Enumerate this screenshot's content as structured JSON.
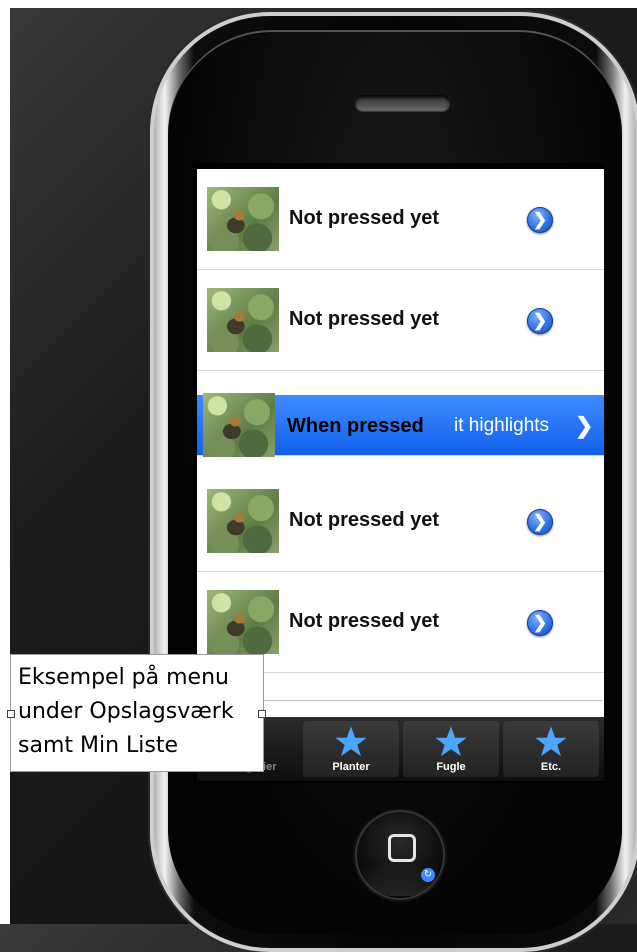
{
  "list": {
    "rows": [
      {
        "label": "Not pressed yet",
        "disclosure": "❯"
      },
      {
        "label": "Not pressed yet",
        "disclosure": "❯"
      },
      {
        "label": "When pressed",
        "hint": "it highlights",
        "chevron": "❯"
      },
      {
        "label": "Not pressed yet",
        "disclosure": "❯"
      },
      {
        "label": "Not pressed yet",
        "disclosure": "❯"
      }
    ]
  },
  "tabbar": {
    "tabs": [
      {
        "label": "Kategorier",
        "icon": "star-icon"
      },
      {
        "label": "Planter",
        "icon": "star-icon"
      },
      {
        "label": "Fugle",
        "icon": "star-icon"
      },
      {
        "label": "Etc.",
        "icon": "star-icon"
      }
    ]
  },
  "home": {
    "badge": "↻"
  },
  "annotation": {
    "lines": [
      "Eksempel på menu",
      "under Opslagsværk",
      "samt Min Liste"
    ]
  },
  "colors": {
    "highlight": "#1a6cf5",
    "disclosure": "#2f6fe0",
    "star": "#4aa6ff"
  }
}
